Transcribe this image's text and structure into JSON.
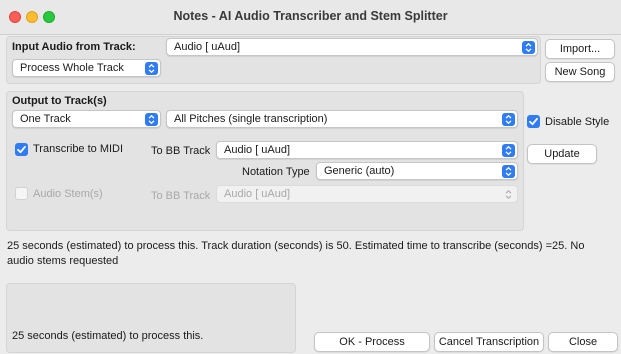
{
  "window": {
    "title": "Notes - AI Audio Transcriber and Stem Splitter"
  },
  "input": {
    "label": "Input Audio from Track:",
    "track_value": "Audio  [ uAud]",
    "import_label": "Import...",
    "new_song_label": "New Song",
    "range_value": "Process Whole Track"
  },
  "output": {
    "heading": "Output to Track(s)",
    "tracks_value": "One Track",
    "pitches_value": "All Pitches (single transcription)",
    "disable_style_label": "Disable Style",
    "disable_style_checked": true,
    "transcribe_midi_label": "Transcribe to MIDI",
    "transcribe_midi_checked": true,
    "to_bb_track_label": "To BB Track",
    "midi_track_value": "Audio  [ uAud]",
    "update_label": "Update",
    "notation_type_label": "Notation Type",
    "notation_type_value": "Generic (auto)",
    "audio_stems_label": "Audio Stem(s)",
    "audio_stems_checked": false,
    "to_bb_track_label_2": "To BB Track",
    "stem_track_value": "Audio  [ uAud]"
  },
  "status": {
    "message": "25 seconds (estimated) to process this. Track duration (seconds) is 50. Estimated time to transcribe (seconds) =25. No audio stems requested",
    "summary": "25 seconds (estimated) to process this."
  },
  "footer": {
    "ok_label": "OK - Process",
    "cancel_label": "Cancel Transcription",
    "close_label": "Close"
  },
  "colors": {
    "accent": "#2f7cf6",
    "close": "#ff5f57",
    "minimize": "#febc2e",
    "zoom": "#28c840"
  }
}
